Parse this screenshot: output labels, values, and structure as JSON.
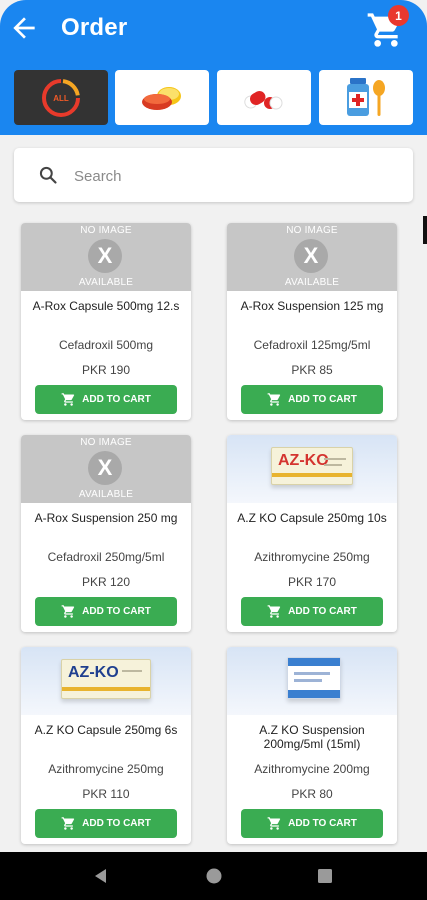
{
  "header": {
    "title": "Order",
    "cart_count": "1"
  },
  "categories": [
    {
      "name": "all",
      "label": "ALL",
      "active": true
    },
    {
      "name": "tablets",
      "active": false
    },
    {
      "name": "capsules",
      "active": false
    },
    {
      "name": "syrups",
      "active": false
    }
  ],
  "search": {
    "placeholder": "Search"
  },
  "no_image": {
    "top": "NO IMAGE",
    "x": "X",
    "bottom": "AVAILABLE"
  },
  "product_box": {
    "brand": "AZ-KO"
  },
  "products": [
    {
      "name": "A-Rox Capsule 500mg 12.s",
      "generic": "Cefadroxil 500mg",
      "price": "PKR 190",
      "button": "ADD TO CART"
    },
    {
      "name": "A-Rox Suspension 125 mg",
      "generic": "Cefadroxil 125mg/5ml",
      "price": "PKR 85",
      "button": "ADD TO CART"
    },
    {
      "name": "A-Rox Suspension 250 mg",
      "generic": "Cefadroxil 250mg/5ml",
      "price": "PKR 120",
      "button": "ADD TO CART"
    },
    {
      "name": "A.Z KO Capsule 250mg 10s",
      "generic": "Azithromycine 250mg",
      "price": "PKR 170",
      "button": "ADD TO CART"
    },
    {
      "name": "A.Z KO Capsule 250mg 6s",
      "generic": "Azithromycine 250mg",
      "price": "PKR 110",
      "button": "ADD TO CART"
    },
    {
      "name": "A.Z KO Suspension 200mg/5ml (15ml)",
      "generic": "Azithromycine 200mg",
      "price": "PKR 80",
      "button": "ADD TO CART"
    }
  ],
  "colors": {
    "app_bar": "#1a86f0",
    "add_button": "#3aac52",
    "badge": "#e9382e"
  },
  "icons": [
    "back-arrow-icon",
    "cart-icon",
    "search-icon",
    "pill-icon",
    "capsule-icon",
    "syrup-icon"
  ]
}
